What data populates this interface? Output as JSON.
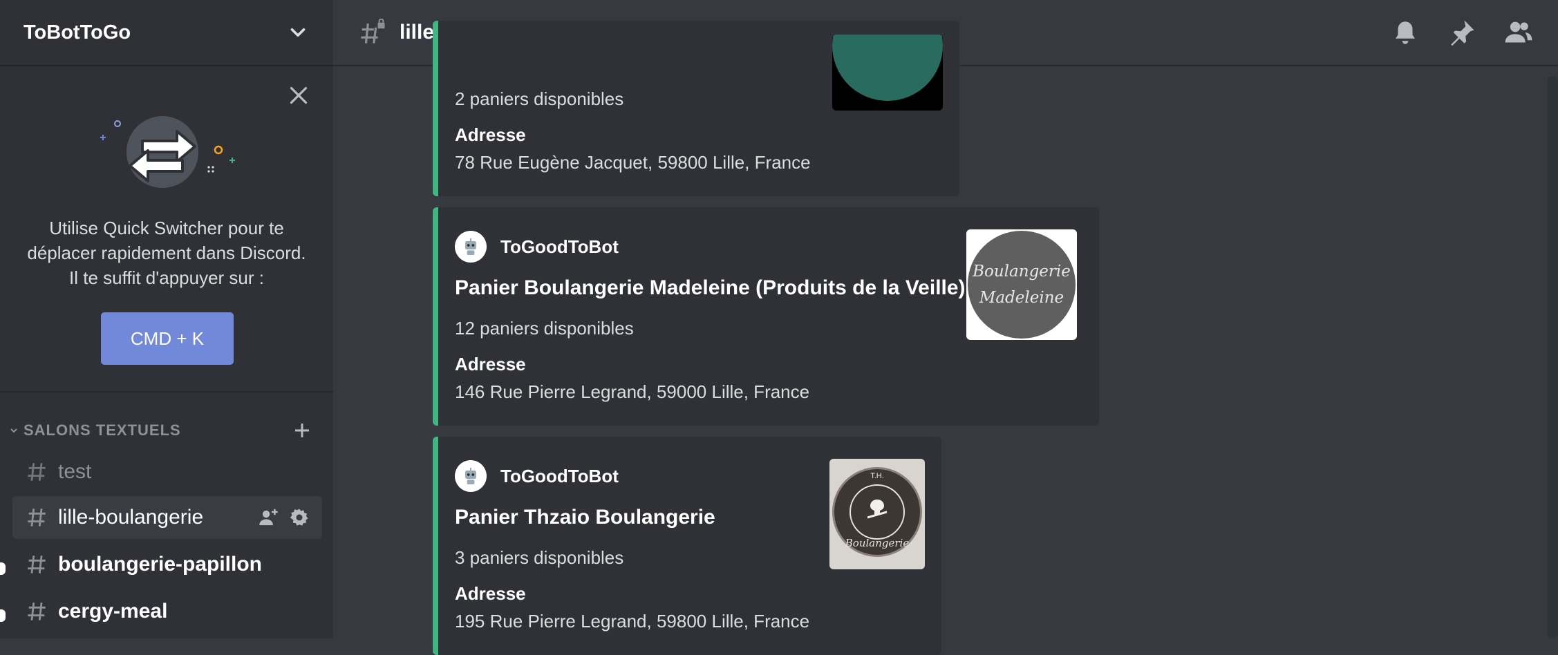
{
  "server": {
    "name": "ToBotToGo"
  },
  "quick_switcher": {
    "text": "Utilise Quick Switcher pour te déplacer rapidement dans Discord. Il te suffit d'appuyer sur :",
    "button_label": "CMD + K"
  },
  "category": {
    "label": "SALONS TEXTUELS"
  },
  "channels": [
    {
      "label": "test",
      "state": "muted"
    },
    {
      "label": "lille-boulangerie",
      "state": "selected"
    },
    {
      "label": "boulangerie-papillon",
      "state": "unread"
    },
    {
      "label": "cergy-meal",
      "state": "unread"
    }
  ],
  "topbar": {
    "channel_name": "lille-boulangerie"
  },
  "embeds": [
    {
      "available": "2 paniers disponibles",
      "address_label": "Adresse",
      "address": "78 Rue Eugène Jacquet, 59800 Lille, France"
    },
    {
      "bot_name": "ToGoodToBot",
      "title": "Panier Boulangerie Madeleine (Produits de la Veille)",
      "available": "12 paniers disponibles",
      "address_label": "Adresse",
      "address": "146 Rue Pierre Legrand, 59000 Lille, France",
      "logo_line1": "Boulangerie",
      "logo_line2": "Madeleine"
    },
    {
      "bot_name": "ToGoodToBot",
      "title": "Panier Thzaio Boulangerie",
      "available": "3 paniers disponibles",
      "address_label": "Adresse",
      "address": "195 Rue Pierre Legrand, 59800 Lille, France",
      "logo_text": "Boulangerie",
      "logo_mono": "T.H."
    }
  ],
  "colors": {
    "sidebar_bg": "#2f3136",
    "main_bg": "#36393f",
    "embed_bg": "#2f3136",
    "embed_accent": "#43b581",
    "button_blurple": "#7289da"
  }
}
